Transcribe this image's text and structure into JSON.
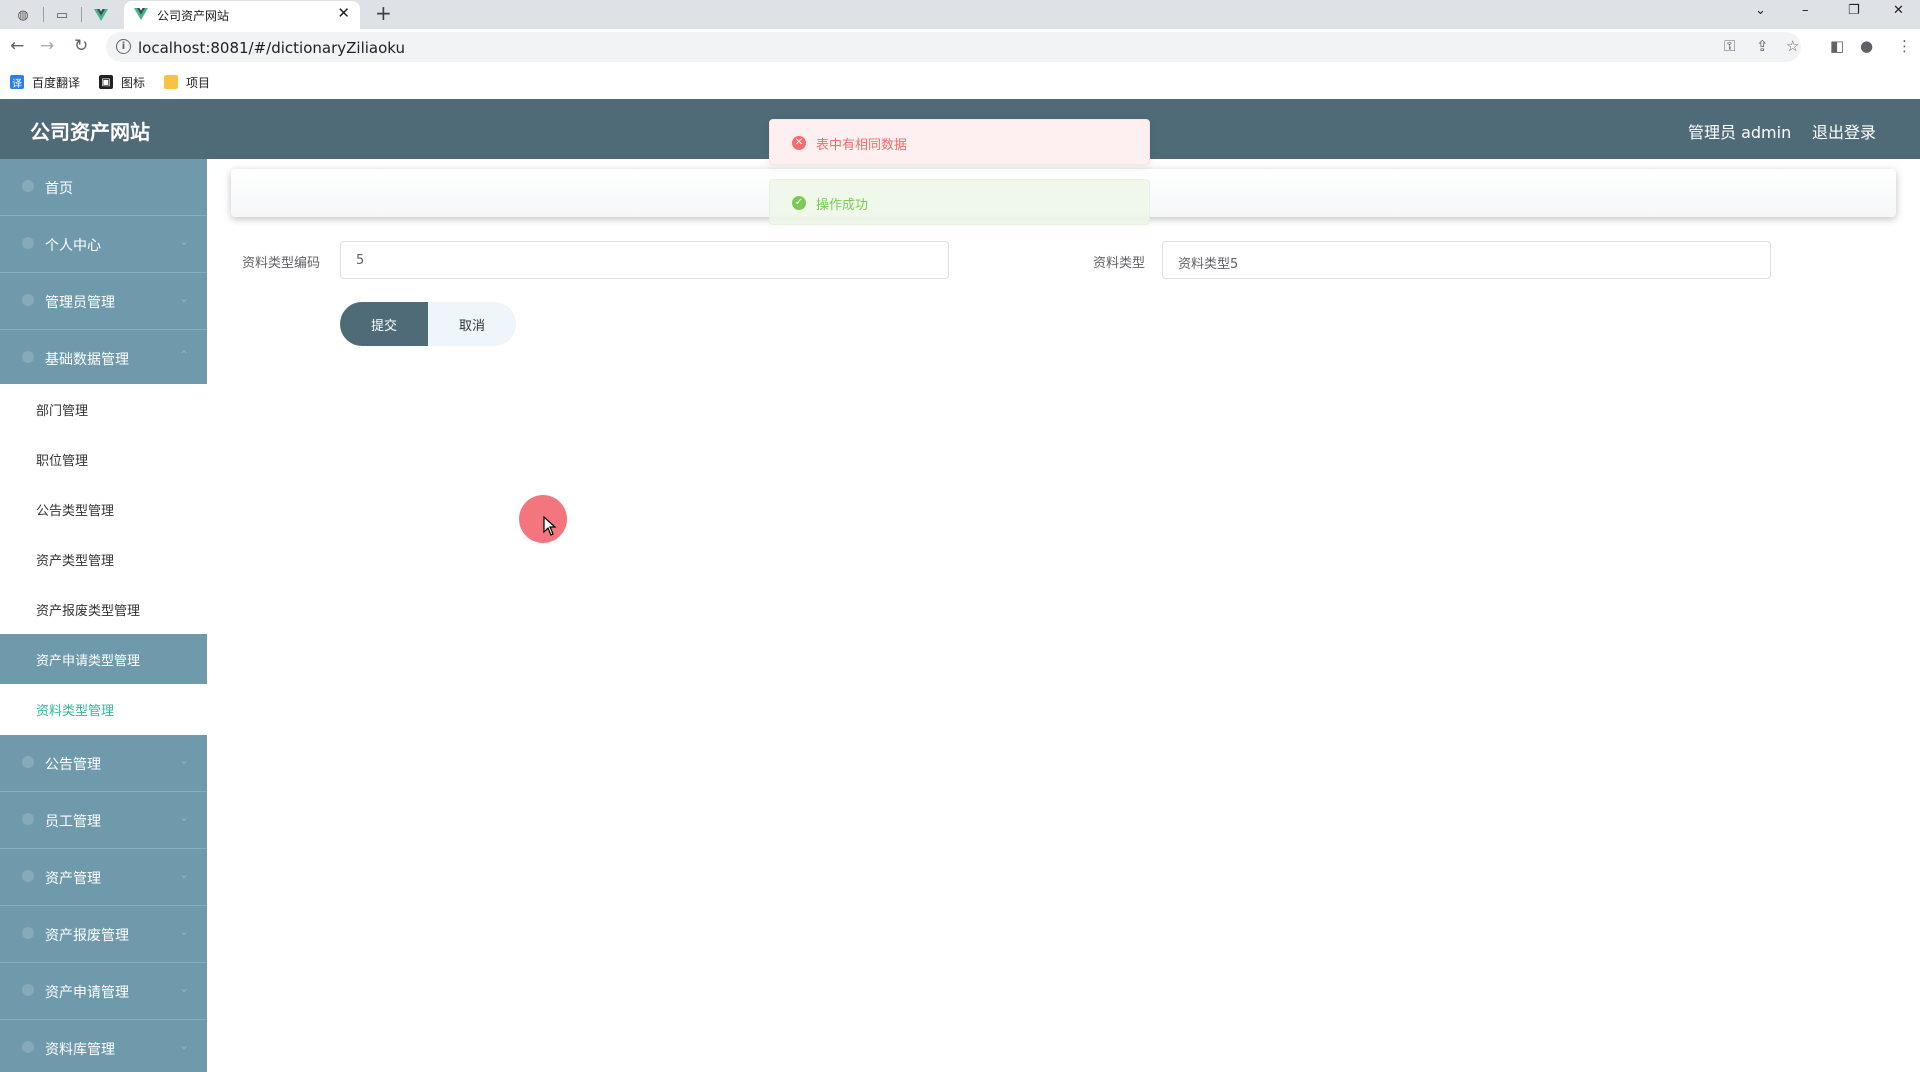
{
  "browser": {
    "tab_title": "公司资产网站",
    "url": "localhost:8081/#/dictionaryZiliaoku",
    "bookmarks": [
      {
        "label": "百度翻译"
      },
      {
        "label": "图标"
      },
      {
        "label": "项目"
      }
    ]
  },
  "header": {
    "brand": "公司资产网站",
    "user": "管理员 admin",
    "logout": "退出登录"
  },
  "sidebar": {
    "top_items": [
      {
        "label": "首页"
      },
      {
        "label": "个人中心"
      },
      {
        "label": "管理员管理"
      },
      {
        "label": "基础数据管理"
      }
    ],
    "sub_items": [
      {
        "label": "部门管理"
      },
      {
        "label": "职位管理"
      },
      {
        "label": "公告类型管理"
      },
      {
        "label": "资产类型管理"
      },
      {
        "label": "资产报废类型管理"
      },
      {
        "label": "资产申请类型管理"
      },
      {
        "label": "资料类型管理"
      }
    ],
    "bottom_items": [
      {
        "label": "公告管理"
      },
      {
        "label": "员工管理"
      },
      {
        "label": "资产管理"
      },
      {
        "label": "资产报废管理"
      },
      {
        "label": "资产申请管理"
      },
      {
        "label": "资料库管理"
      }
    ]
  },
  "form": {
    "code_label": "资料类型编码",
    "code_value": "5",
    "type_label": "资料类型",
    "type_value": "资料类型5",
    "submit": "提交",
    "cancel": "取消"
  },
  "toasts": {
    "error": "表中有相同数据",
    "success": "操作成功"
  },
  "colors": {
    "header": "#4f6b78",
    "sidebar": "#6e9aac",
    "active_sub": "#2fb99b",
    "error_toast": "#fef0f0",
    "success_toast": "#eef8e8"
  }
}
